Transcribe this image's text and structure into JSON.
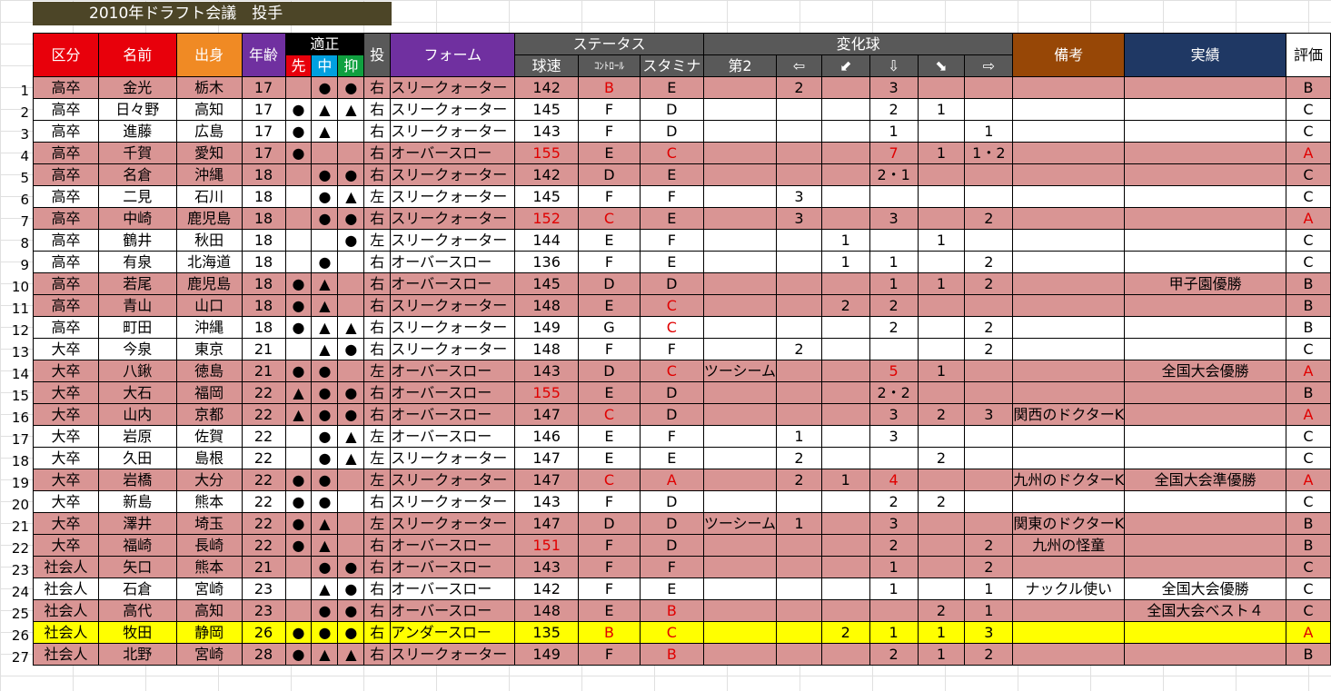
{
  "title": "2010年ドラフト会議　投手",
  "headers": {
    "kubun": "区分",
    "namae": "名前",
    "shusshin": "出身",
    "nenrei": "年齢",
    "tekisei": "適正",
    "sen": "先",
    "chu": "中",
    "yoku": "抑",
    "tou": "投",
    "form": "フォーム",
    "status": "ステータス",
    "kyusoku": "球速",
    "control": "ｺﾝﾄﾛｰﾙ",
    "stamina": "スタミナ",
    "henkakyu": "変化球",
    "dai2": "第2",
    "arrow_left": "⇦",
    "arrow_downleft": "⬋",
    "arrow_down": "⇩",
    "arrow_downright": "⬊",
    "arrow_right": "⇨",
    "biko": "備考",
    "jisseki": "実績",
    "hyoka": "評価"
  },
  "rows": [
    {
      "no": "1",
      "kubun": "高卒",
      "namae": "金光",
      "shusshin": "栃木",
      "nenrei": "17",
      "sen": "",
      "chu": "●",
      "yoku": "●",
      "tou": "右",
      "form": "スリークォーター",
      "kyusoku": "142",
      "control": "B",
      "stamina": "E",
      "dai2": "",
      "l": "2",
      "dl": "",
      "d": "3",
      "dr": "",
      "r": "",
      "biko": "",
      "jisseki": "",
      "hyoka": "B",
      "color": "pink",
      "red": [
        "control"
      ]
    },
    {
      "no": "2",
      "kubun": "高卒",
      "namae": "日々野",
      "shusshin": "高知",
      "nenrei": "17",
      "sen": "●",
      "chu": "▲",
      "yoku": "▲",
      "tou": "右",
      "form": "スリークォーター",
      "kyusoku": "145",
      "control": "F",
      "stamina": "D",
      "dai2": "",
      "l": "",
      "dl": "",
      "d": "2",
      "dr": "1",
      "r": "",
      "biko": "",
      "jisseki": "",
      "hyoka": "C",
      "color": "white",
      "red": []
    },
    {
      "no": "3",
      "kubun": "高卒",
      "namae": "進藤",
      "shusshin": "広島",
      "nenrei": "17",
      "sen": "●",
      "chu": "▲",
      "yoku": "",
      "tou": "右",
      "form": "スリークォーター",
      "kyusoku": "143",
      "control": "F",
      "stamina": "D",
      "dai2": "",
      "l": "",
      "dl": "",
      "d": "1",
      "dr": "",
      "r": "1",
      "biko": "",
      "jisseki": "",
      "hyoka": "C",
      "color": "white",
      "red": []
    },
    {
      "no": "4",
      "kubun": "高卒",
      "namae": "千賀",
      "shusshin": "愛知",
      "nenrei": "17",
      "sen": "●",
      "chu": "",
      "yoku": "",
      "tou": "右",
      "form": "オーバースロー",
      "kyusoku": "155",
      "control": "E",
      "stamina": "C",
      "dai2": "",
      "l": "",
      "dl": "",
      "d": "7",
      "dr": "1",
      "r": "1・2",
      "biko": "",
      "jisseki": "",
      "hyoka": "A",
      "color": "pink",
      "red": [
        "kyusoku",
        "stamina",
        "d",
        "hyoka"
      ]
    },
    {
      "no": "5",
      "kubun": "高卒",
      "namae": "名倉",
      "shusshin": "沖縄",
      "nenrei": "18",
      "sen": "",
      "chu": "●",
      "yoku": "●",
      "tou": "右",
      "form": "スリークォーター",
      "kyusoku": "142",
      "control": "D",
      "stamina": "E",
      "dai2": "",
      "l": "",
      "dl": "",
      "d": "2・1",
      "dr": "",
      "r": "",
      "biko": "",
      "jisseki": "",
      "hyoka": "C",
      "color": "pink",
      "red": []
    },
    {
      "no": "6",
      "kubun": "高卒",
      "namae": "二見",
      "shusshin": "石川",
      "nenrei": "18",
      "sen": "",
      "chu": "●",
      "yoku": "▲",
      "tou": "左",
      "form": "スリークォーター",
      "kyusoku": "145",
      "control": "F",
      "stamina": "F",
      "dai2": "",
      "l": "3",
      "dl": "",
      "d": "",
      "dr": "",
      "r": "",
      "biko": "",
      "jisseki": "",
      "hyoka": "C",
      "color": "white",
      "red": []
    },
    {
      "no": "7",
      "kubun": "高卒",
      "namae": "中崎",
      "shusshin": "鹿児島",
      "nenrei": "18",
      "sen": "",
      "chu": "●",
      "yoku": "●",
      "tou": "右",
      "form": "スリークォーター",
      "kyusoku": "152",
      "control": "C",
      "stamina": "E",
      "dai2": "",
      "l": "3",
      "dl": "",
      "d": "3",
      "dr": "",
      "r": "2",
      "biko": "",
      "jisseki": "",
      "hyoka": "A",
      "color": "pink",
      "red": [
        "kyusoku",
        "control",
        "hyoka"
      ]
    },
    {
      "no": "8",
      "kubun": "高卒",
      "namae": "鶴井",
      "shusshin": "秋田",
      "nenrei": "18",
      "sen": "",
      "chu": "",
      "yoku": "●",
      "tou": "左",
      "form": "スリークォーター",
      "kyusoku": "144",
      "control": "E",
      "stamina": "F",
      "dai2": "",
      "l": "",
      "dl": "1",
      "d": "",
      "dr": "1",
      "r": "",
      "biko": "",
      "jisseki": "",
      "hyoka": "C",
      "color": "white",
      "red": []
    },
    {
      "no": "9",
      "kubun": "高卒",
      "namae": "有泉",
      "shusshin": "北海道",
      "nenrei": "18",
      "sen": "",
      "chu": "●",
      "yoku": "",
      "tou": "右",
      "form": "オーバースロー",
      "kyusoku": "136",
      "control": "F",
      "stamina": "E",
      "dai2": "",
      "l": "",
      "dl": "1",
      "d": "1",
      "dr": "",
      "r": "2",
      "biko": "",
      "jisseki": "",
      "hyoka": "C",
      "color": "white",
      "red": []
    },
    {
      "no": "10",
      "kubun": "高卒",
      "namae": "若尾",
      "shusshin": "鹿児島",
      "nenrei": "18",
      "sen": "●",
      "chu": "▲",
      "yoku": "",
      "tou": "右",
      "form": "オーバースロー",
      "kyusoku": "145",
      "control": "D",
      "stamina": "D",
      "dai2": "",
      "l": "",
      "dl": "",
      "d": "1",
      "dr": "1",
      "r": "2",
      "biko": "",
      "jisseki": "甲子園優勝",
      "hyoka": "B",
      "color": "pink",
      "red": []
    },
    {
      "no": "11",
      "kubun": "高卒",
      "namae": "青山",
      "shusshin": "山口",
      "nenrei": "18",
      "sen": "●",
      "chu": "▲",
      "yoku": "",
      "tou": "右",
      "form": "スリークォーター",
      "kyusoku": "148",
      "control": "E",
      "stamina": "C",
      "dai2": "",
      "l": "",
      "dl": "2",
      "d": "2",
      "dr": "",
      "r": "",
      "biko": "",
      "jisseki": "",
      "hyoka": "B",
      "color": "pink",
      "red": [
        "stamina"
      ]
    },
    {
      "no": "12",
      "kubun": "高卒",
      "namae": "町田",
      "shusshin": "沖縄",
      "nenrei": "18",
      "sen": "●",
      "chu": "▲",
      "yoku": "▲",
      "tou": "右",
      "form": "スリークォーター",
      "kyusoku": "149",
      "control": "G",
      "stamina": "C",
      "dai2": "",
      "l": "",
      "dl": "",
      "d": "2",
      "dr": "",
      "r": "2",
      "biko": "",
      "jisseki": "",
      "hyoka": "B",
      "color": "white",
      "red": [
        "stamina"
      ]
    },
    {
      "no": "13",
      "kubun": "大卒",
      "namae": "今泉",
      "shusshin": "東京",
      "nenrei": "21",
      "sen": "",
      "chu": "▲",
      "yoku": "●",
      "tou": "右",
      "form": "スリークォーター",
      "kyusoku": "148",
      "control": "F",
      "stamina": "F",
      "dai2": "",
      "l": "2",
      "dl": "",
      "d": "",
      "dr": "",
      "r": "2",
      "biko": "",
      "jisseki": "",
      "hyoka": "C",
      "color": "white",
      "red": []
    },
    {
      "no": "14",
      "kubun": "大卒",
      "namae": "八鍬",
      "shusshin": "徳島",
      "nenrei": "21",
      "sen": "●",
      "chu": "●",
      "yoku": "",
      "tou": "左",
      "form": "オーバースロー",
      "kyusoku": "143",
      "control": "D",
      "stamina": "C",
      "dai2": "ツーシーム",
      "l": "",
      "dl": "",
      "d": "5",
      "dr": "1",
      "r": "",
      "biko": "",
      "jisseki": "全国大会優勝",
      "hyoka": "A",
      "color": "pink",
      "red": [
        "stamina",
        "d",
        "hyoka"
      ]
    },
    {
      "no": "15",
      "kubun": "大卒",
      "namae": "大石",
      "shusshin": "福岡",
      "nenrei": "22",
      "sen": "▲",
      "chu": "●",
      "yoku": "●",
      "tou": "右",
      "form": "オーバースロー",
      "kyusoku": "155",
      "control": "E",
      "stamina": "D",
      "dai2": "",
      "l": "",
      "dl": "",
      "d": "2・2",
      "dr": "",
      "r": "",
      "biko": "",
      "jisseki": "",
      "hyoka": "B",
      "color": "pink",
      "red": [
        "kyusoku"
      ]
    },
    {
      "no": "16",
      "kubun": "大卒",
      "namae": "山内",
      "shusshin": "京都",
      "nenrei": "22",
      "sen": "▲",
      "chu": "●",
      "yoku": "●",
      "tou": "右",
      "form": "オーバースロー",
      "kyusoku": "147",
      "control": "C",
      "stamina": "D",
      "dai2": "",
      "l": "",
      "dl": "",
      "d": "3",
      "dr": "2",
      "r": "3",
      "biko": "関西のドクターK",
      "jisseki": "",
      "hyoka": "A",
      "color": "pink",
      "red": [
        "control",
        "hyoka"
      ]
    },
    {
      "no": "17",
      "kubun": "大卒",
      "namae": "岩原",
      "shusshin": "佐賀",
      "nenrei": "22",
      "sen": "",
      "chu": "●",
      "yoku": "▲",
      "tou": "左",
      "form": "オーバースロー",
      "kyusoku": "146",
      "control": "E",
      "stamina": "F",
      "dai2": "",
      "l": "1",
      "dl": "",
      "d": "3",
      "dr": "",
      "r": "",
      "biko": "",
      "jisseki": "",
      "hyoka": "C",
      "color": "white",
      "red": []
    },
    {
      "no": "18",
      "kubun": "大卒",
      "namae": "久田",
      "shusshin": "島根",
      "nenrei": "22",
      "sen": "",
      "chu": "●",
      "yoku": "▲",
      "tou": "左",
      "form": "スリークォーター",
      "kyusoku": "147",
      "control": "E",
      "stamina": "E",
      "dai2": "",
      "l": "2",
      "dl": "",
      "d": "",
      "dr": "2",
      "r": "",
      "biko": "",
      "jisseki": "",
      "hyoka": "C",
      "color": "white",
      "red": []
    },
    {
      "no": "19",
      "kubun": "大卒",
      "namae": "岩橋",
      "shusshin": "大分",
      "nenrei": "22",
      "sen": "●",
      "chu": "●",
      "yoku": "",
      "tou": "左",
      "form": "スリークォーター",
      "kyusoku": "147",
      "control": "C",
      "stamina": "A",
      "dai2": "",
      "l": "2",
      "dl": "1",
      "d": "4",
      "dr": "",
      "r": "",
      "biko": "九州のドクターK",
      "jisseki": "全国大会準優勝",
      "hyoka": "A",
      "color": "pink",
      "red": [
        "control",
        "stamina",
        "d",
        "hyoka"
      ]
    },
    {
      "no": "20",
      "kubun": "大卒",
      "namae": "新島",
      "shusshin": "熊本",
      "nenrei": "22",
      "sen": "●",
      "chu": "●",
      "yoku": "",
      "tou": "右",
      "form": "スリークォーター",
      "kyusoku": "143",
      "control": "F",
      "stamina": "D",
      "dai2": "",
      "l": "",
      "dl": "",
      "d": "2",
      "dr": "2",
      "r": "",
      "biko": "",
      "jisseki": "",
      "hyoka": "C",
      "color": "white",
      "red": []
    },
    {
      "no": "21",
      "kubun": "大卒",
      "namae": "澤井",
      "shusshin": "埼玉",
      "nenrei": "22",
      "sen": "●",
      "chu": "▲",
      "yoku": "",
      "tou": "左",
      "form": "スリークォーター",
      "kyusoku": "147",
      "control": "D",
      "stamina": "D",
      "dai2": "ツーシーム",
      "l": "1",
      "dl": "",
      "d": "3",
      "dr": "",
      "r": "",
      "biko": "関東のドクターK",
      "jisseki": "",
      "hyoka": "B",
      "color": "pink",
      "red": []
    },
    {
      "no": "22",
      "kubun": "大卒",
      "namae": "福崎",
      "shusshin": "長崎",
      "nenrei": "22",
      "sen": "●",
      "chu": "▲",
      "yoku": "",
      "tou": "右",
      "form": "オーバースロー",
      "kyusoku": "151",
      "control": "F",
      "stamina": "D",
      "dai2": "",
      "l": "",
      "dl": "",
      "d": "2",
      "dr": "",
      "r": "2",
      "biko": "九州の怪童",
      "jisseki": "",
      "hyoka": "B",
      "color": "pink",
      "red": [
        "kyusoku"
      ]
    },
    {
      "no": "23",
      "kubun": "社会人",
      "namae": "矢口",
      "shusshin": "熊本",
      "nenrei": "21",
      "sen": "",
      "chu": "●",
      "yoku": "●",
      "tou": "右",
      "form": "オーバースロー",
      "kyusoku": "143",
      "control": "F",
      "stamina": "F",
      "dai2": "",
      "l": "",
      "dl": "",
      "d": "1",
      "dr": "",
      "r": "2",
      "biko": "",
      "jisseki": "",
      "hyoka": "C",
      "color": "pink",
      "red": []
    },
    {
      "no": "24",
      "kubun": "社会人",
      "namae": "石倉",
      "shusshin": "宮崎",
      "nenrei": "23",
      "sen": "",
      "chu": "▲",
      "yoku": "●",
      "tou": "右",
      "form": "オーバースロー",
      "kyusoku": "142",
      "control": "F",
      "stamina": "E",
      "dai2": "",
      "l": "",
      "dl": "",
      "d": "1",
      "dr": "",
      "r": "1",
      "biko": "ナックル使い",
      "jisseki": "全国大会優勝",
      "hyoka": "C",
      "color": "white",
      "red": []
    },
    {
      "no": "25",
      "kubun": "社会人",
      "namae": "高代",
      "shusshin": "高知",
      "nenrei": "23",
      "sen": "",
      "chu": "●",
      "yoku": "●",
      "tou": "右",
      "form": "オーバースロー",
      "kyusoku": "148",
      "control": "E",
      "stamina": "B",
      "dai2": "",
      "l": "",
      "dl": "",
      "d": "",
      "dr": "2",
      "r": "1",
      "biko": "",
      "jisseki": "全国大会ベスト４",
      "hyoka": "C",
      "color": "pink",
      "red": [
        "stamina"
      ]
    },
    {
      "no": "26",
      "kubun": "社会人",
      "namae": "牧田",
      "shusshin": "静岡",
      "nenrei": "26",
      "sen": "●",
      "chu": "●",
      "yoku": "●",
      "tou": "右",
      "form": "アンダースロー",
      "kyusoku": "135",
      "control": "B",
      "stamina": "C",
      "dai2": "",
      "l": "",
      "dl": "2",
      "d": "1",
      "dr": "1",
      "r": "3",
      "biko": "",
      "jisseki": "",
      "hyoka": "A",
      "color": "yellow",
      "red": [
        "control",
        "stamina",
        "hyoka"
      ]
    },
    {
      "no": "27",
      "kubun": "社会人",
      "namae": "北野",
      "shusshin": "宮崎",
      "nenrei": "28",
      "sen": "●",
      "chu": "▲",
      "yoku": "▲",
      "tou": "右",
      "form": "スリークォーター",
      "kyusoku": "149",
      "control": "F",
      "stamina": "B",
      "dai2": "",
      "l": "",
      "dl": "",
      "d": "2",
      "dr": "1",
      "r": "2",
      "biko": "",
      "jisseki": "",
      "hyoka": "B",
      "color": "pink",
      "red": [
        "stamina"
      ]
    }
  ],
  "colors": {
    "pink_row": "#d99594",
    "yellow_row": "#ffff00",
    "red_text": "#e00000",
    "title_bg": "#4c4527",
    "header_red": "#e8000b",
    "header_orange": "#f08a24",
    "header_purple": "#7030a0",
    "header_gray": "#595959",
    "header_brown": "#974706",
    "header_navy": "#1f3864"
  }
}
